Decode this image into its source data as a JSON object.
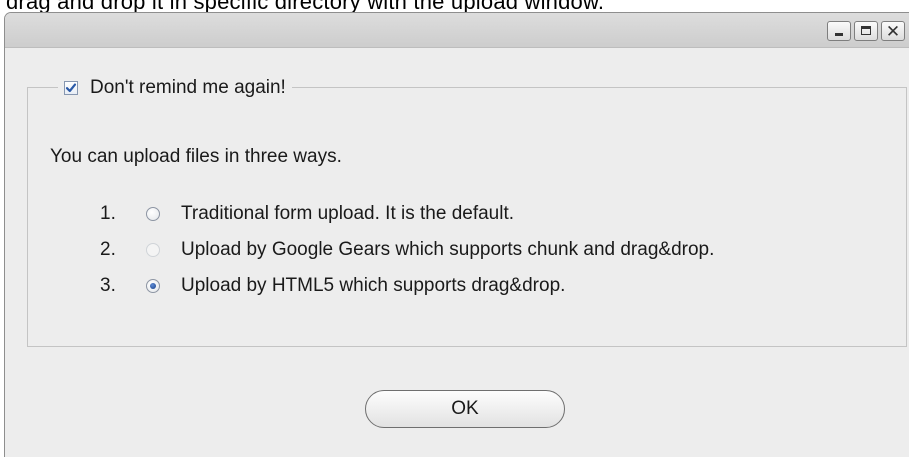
{
  "top_strip_text": "drag and drop it in specific directory with the upload window.",
  "window": {
    "controls": {
      "minimize_icon": "minimize-icon",
      "maximize_icon": "maximize-icon",
      "close_icon": "close-icon",
      "close_glyph": "✕"
    },
    "reminder_checkbox": {
      "label": "Don't remind me again!",
      "checked": true
    },
    "intro_text": "You can upload files in three ways.",
    "options": [
      {
        "number": "1.",
        "label": "Traditional form upload. It is the default.",
        "selected": false,
        "enabled": true
      },
      {
        "number": "2.",
        "label": "Upload by Google Gears which supports chunk and drag&drop.",
        "selected": false,
        "enabled": false
      },
      {
        "number": "3.",
        "label": "Upload by HTML5 which supports drag&drop.",
        "selected": true,
        "enabled": true
      }
    ],
    "ok_label": "OK"
  },
  "colors": {
    "window_bg": "#ededed",
    "titlebar": "#d4d4d4",
    "radio_checked": "#1f4f9e",
    "checkbox_mark": "#2b5aa8"
  }
}
